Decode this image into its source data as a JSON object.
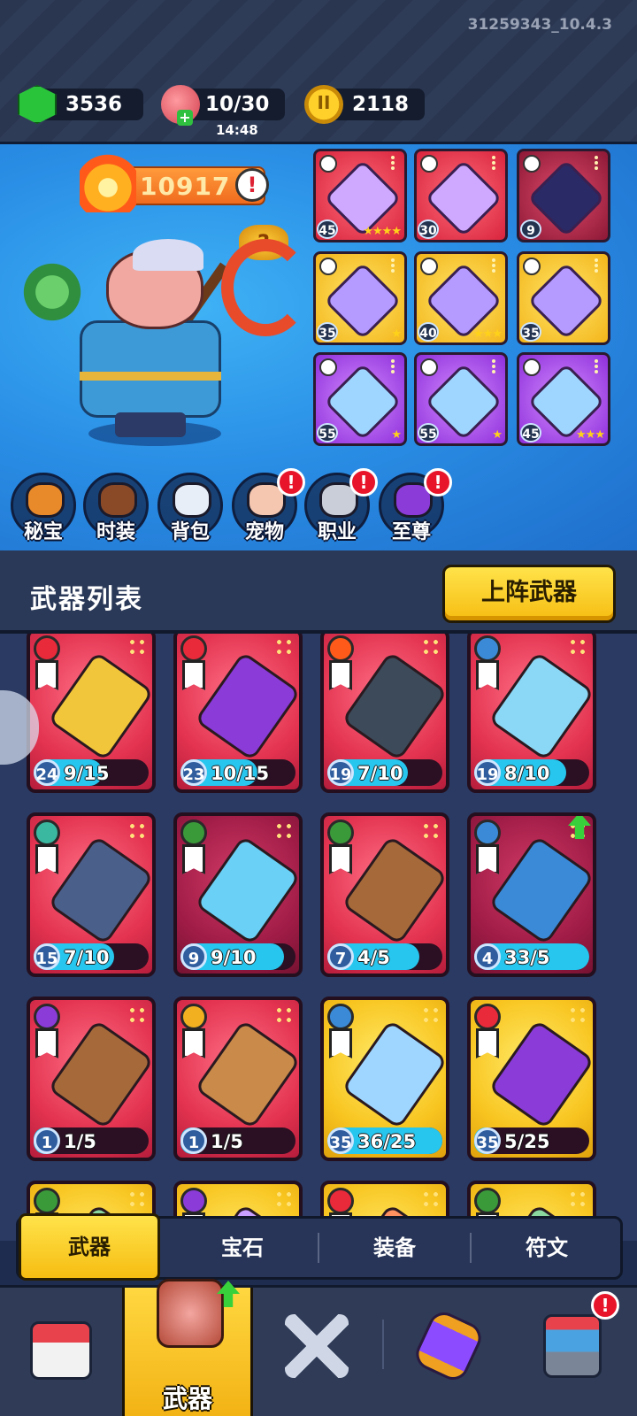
{
  "version": "31259343_10.4.3",
  "resources": {
    "gems": "3536",
    "stamina": "10/30",
    "stamina_timer": "14:48",
    "coins": "2118"
  },
  "hero": {
    "power": "10917",
    "info_icon": "!",
    "mystery_icon": "?"
  },
  "equipped_slots": [
    {
      "level": "45",
      "stars": "★★★★",
      "rarity": "red"
    },
    {
      "level": "30",
      "stars": "",
      "rarity": "red"
    },
    {
      "level": "9",
      "stars": "",
      "rarity": "dark"
    },
    {
      "level": "35",
      "stars": "★",
      "rarity": "yellow"
    },
    {
      "level": "40",
      "stars": "★★★",
      "rarity": "yellow"
    },
    {
      "level": "35",
      "stars": "",
      "rarity": "yellow"
    },
    {
      "level": "55",
      "stars": "★",
      "rarity": "purple"
    },
    {
      "level": "55",
      "stars": "★",
      "rarity": "purple"
    },
    {
      "level": "45",
      "stars": "★★★",
      "rarity": "purple"
    }
  ],
  "menu": [
    {
      "label": "秘宝",
      "alert": false
    },
    {
      "label": "时装",
      "alert": false
    },
    {
      "label": "背包",
      "alert": false
    },
    {
      "label": "宠物",
      "alert": true
    },
    {
      "label": "职业",
      "alert": true
    },
    {
      "label": "至尊",
      "alert": true
    }
  ],
  "alert_symbol": "!",
  "weapon_list": {
    "title": "武器列表",
    "deploy_button": "上阵武器"
  },
  "weapons": [
    {
      "level": "24",
      "count": "9/15",
      "progress": 0.6,
      "rarity": "red"
    },
    {
      "level": "23",
      "count": "10/15",
      "progress": 0.67,
      "rarity": "red"
    },
    {
      "level": "19",
      "count": "7/10",
      "progress": 0.7,
      "rarity": "red"
    },
    {
      "level": "19",
      "count": "8/10",
      "progress": 0.8,
      "rarity": "red"
    },
    {
      "level": "15",
      "count": "7/10",
      "progress": 0.7,
      "rarity": "red"
    },
    {
      "level": "9",
      "count": "9/10",
      "progress": 0.9,
      "rarity": "maroon"
    },
    {
      "level": "7",
      "count": "4/5",
      "progress": 0.8,
      "rarity": "red"
    },
    {
      "level": "4",
      "count": "33/5",
      "progress": 1.0,
      "rarity": "maroon",
      "upgradable": true
    },
    {
      "level": "1",
      "count": "1/5",
      "progress": 0.2,
      "rarity": "red"
    },
    {
      "level": "1",
      "count": "1/5",
      "progress": 0.2,
      "rarity": "red"
    },
    {
      "level": "35",
      "count": "36/25",
      "progress": 1.0,
      "rarity": "gold"
    },
    {
      "level": "35",
      "count": "5/25",
      "progress": 0.2,
      "rarity": "gold"
    },
    {
      "level": "",
      "count": "",
      "progress": 0,
      "rarity": "gold"
    },
    {
      "level": "",
      "count": "",
      "progress": 0,
      "rarity": "gold"
    },
    {
      "level": "",
      "count": "",
      "progress": 0,
      "rarity": "gold"
    },
    {
      "level": "",
      "count": "",
      "progress": 0,
      "rarity": "gold"
    }
  ],
  "tabs": [
    "武器",
    "宝石",
    "装备",
    "符文"
  ],
  "nav": {
    "active_label": "武器"
  }
}
